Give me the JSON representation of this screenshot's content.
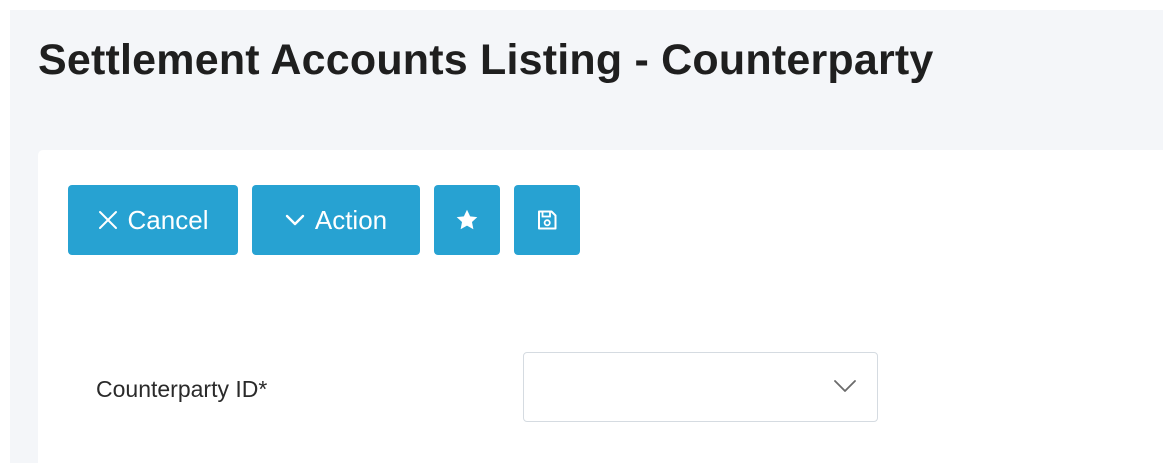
{
  "page": {
    "title": "Settlement Accounts Listing - Counterparty"
  },
  "toolbar": {
    "cancel_label": "Cancel",
    "action_label": "Action",
    "favorite_icon": "star-icon",
    "save_icon": "floppy-disk-icon"
  },
  "form": {
    "counterparty_id": {
      "label": "Counterparty ID*",
      "value": ""
    }
  },
  "colors": {
    "accent": "#27a2d2",
    "page_background": "#f4f6f9",
    "card_background": "#ffffff"
  }
}
